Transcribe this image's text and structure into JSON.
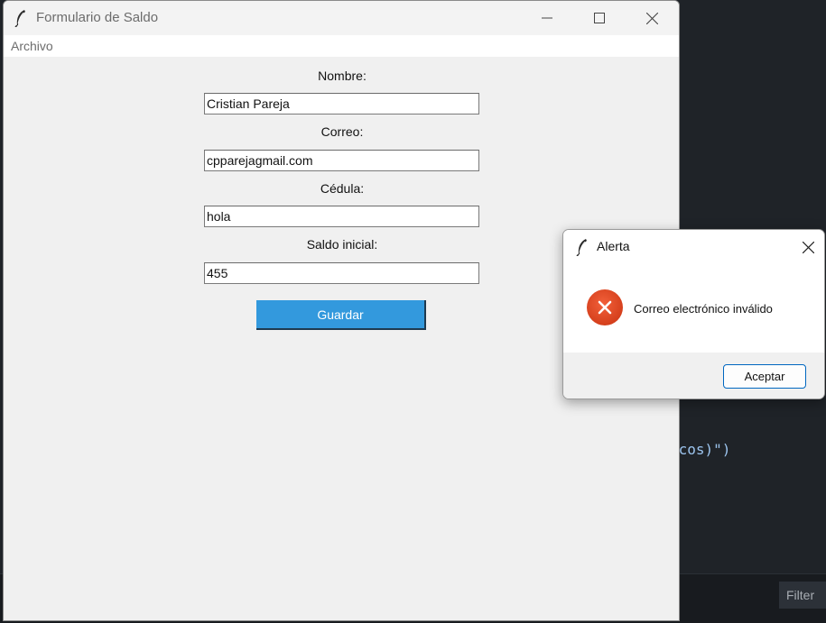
{
  "background": {
    "code_fragment": "icos)\")",
    "filter_label": "Filter"
  },
  "main_window": {
    "title": "Formulario de Saldo",
    "menu": [
      "Archivo"
    ],
    "form": {
      "fields": [
        {
          "label": "Nombre:",
          "value": "Cristian Pareja"
        },
        {
          "label": "Correo:",
          "value": "cpparejagmail.com"
        },
        {
          "label": "Cédula:",
          "value": "hola"
        },
        {
          "label": "Saldo inicial:",
          "value": "455"
        }
      ],
      "save_label": "Guardar"
    },
    "accent_color": "#3399dd"
  },
  "alert": {
    "title": "Alerta",
    "message": "Correo electrónico inválido",
    "ok_label": "Aceptar",
    "icon": "error-icon"
  }
}
